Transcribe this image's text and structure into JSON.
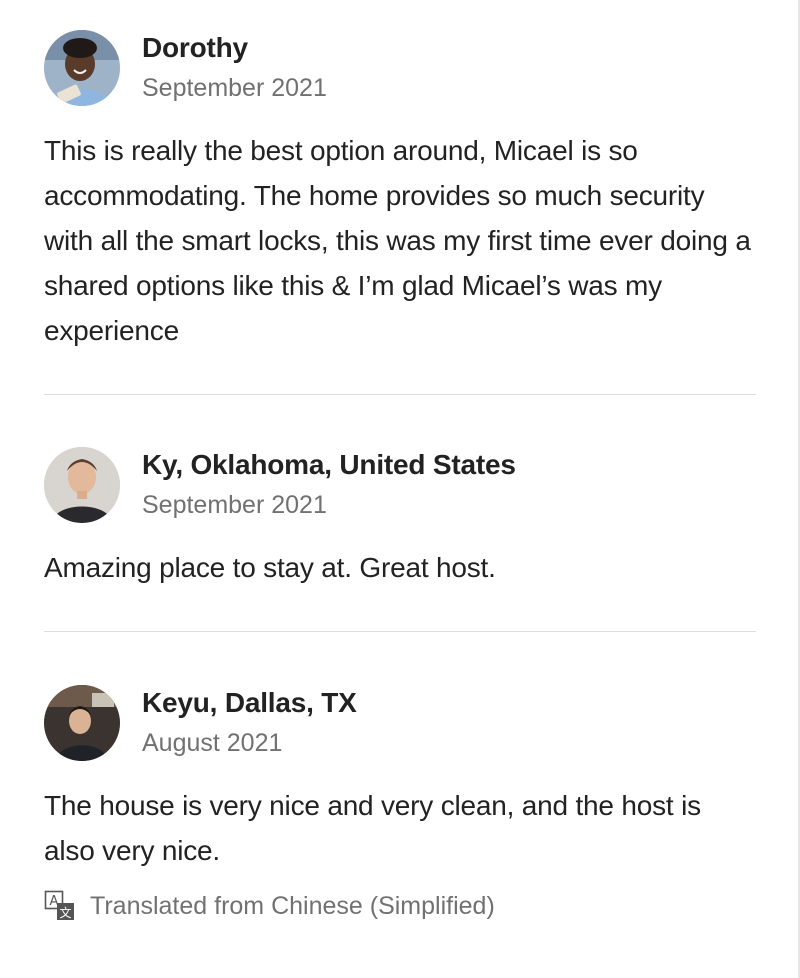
{
  "reviews": [
    {
      "name": "Dorothy",
      "date": "September 2021",
      "text": "This is really the best option around, Micael is so accommodating. The home provides so much security with all the smart locks, this was my first time ever doing a shared options like this & I’m glad Micael’s was my experience",
      "avatar_icon": "user-photo-avatar"
    },
    {
      "name": "Ky, Oklahoma, United States",
      "date": "September 2021",
      "text": "Amazing place to stay at. Great host.",
      "avatar_icon": "user-photo-avatar"
    },
    {
      "name": "Keyu, Dallas, TX",
      "date": "August 2021",
      "text": "The house is very nice and very clean, and the host is also very nice.",
      "translation_note": "Translated from Chinese (Simplified)",
      "translation_icon": "translate-icon",
      "avatar_icon": "user-photo-avatar"
    }
  ],
  "colors": {
    "text_primary": "#222222",
    "text_secondary": "#717171",
    "divider": "#dddddd"
  }
}
